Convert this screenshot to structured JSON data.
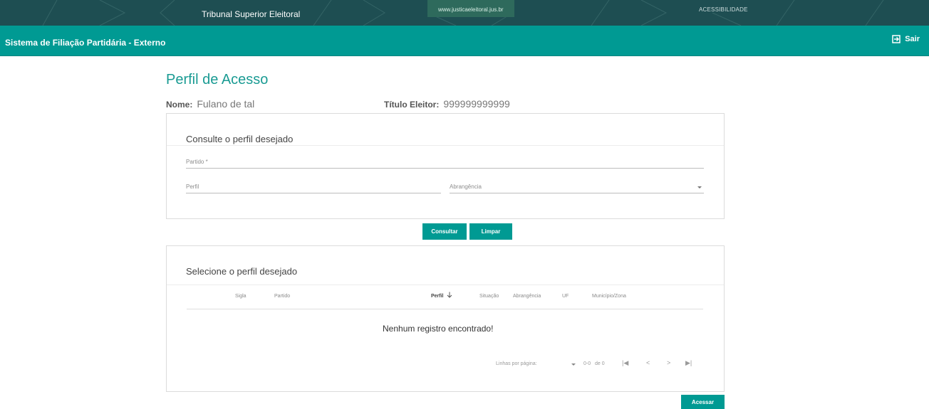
{
  "gov_bar": {
    "title": "Tribunal Superior Eleitoral",
    "link": "www.justicaeleitoral.jus.br",
    "accessibility": "ACESSIBILIDADE"
  },
  "header": {
    "app_title": "Sistema de Filiação Partidária - Externo",
    "logout_label": "Sair",
    "logout_icon": "logout-icon"
  },
  "page": {
    "title": "Perfil de Acesso",
    "name_label": "Nome:",
    "name_value": "Fulano de tal",
    "voter_label": "Título Eleitor:",
    "voter_value": "999999999999"
  },
  "search_card": {
    "heading": "Consulte o perfil desejado",
    "partido_label": "Partido *",
    "perfil_label": "Perfil",
    "abrangencia_label": "Abrangência"
  },
  "buttons": {
    "consultar": "Consultar",
    "limpar": "Limpar",
    "acessar": "Acessar"
  },
  "results_card": {
    "heading": "Selecione o perfil desejado",
    "columns": [
      "Sigla",
      "Partido",
      "Perfil",
      "Situação",
      "Abrangência",
      "UF",
      "Município/Zona"
    ],
    "sorted_column_icon": "arrow-down-icon",
    "empty_message": "Nenhum registro encontrado!"
  },
  "pagination": {
    "rows_label": "Linhas por página:",
    "range": "0-0",
    "of": "de 0",
    "first": "|◀",
    "prev": "<",
    "next": ">",
    "last": "▶|"
  },
  "colors": {
    "primary": "#009a93",
    "gov_bar": "#1e4e52",
    "title": "#1a9b93"
  }
}
